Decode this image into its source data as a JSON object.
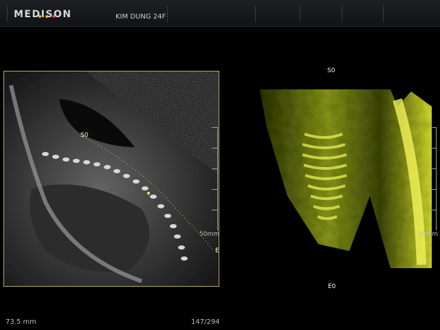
{
  "header": {
    "brand": "MEDISON",
    "patient_label": "KIM DUNG 24F",
    "brand_dots": [
      "#e8b23a",
      "#e8b23a",
      "#e2473c"
    ]
  },
  "left_view": {
    "start_marker": "S0",
    "end_marker": "E",
    "depth_label": "50mm"
  },
  "right_view": {
    "start_marker": "S0",
    "end_marker": "E0",
    "depth_label": "50mm"
  },
  "status": {
    "length": "73.5 mm",
    "frame_counter": "147/294"
  },
  "colors": {
    "frame_border": "#b9a86b",
    "ruler": "#7fae9f",
    "render_tint": "#c8d63a"
  }
}
